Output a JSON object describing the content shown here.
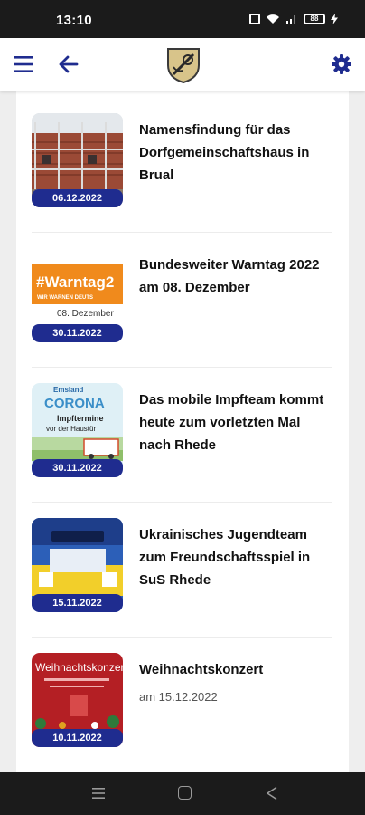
{
  "status_bar": {
    "time": "13:10",
    "battery": "88",
    "icons": [
      "nfc-icon",
      "wifi-icon",
      "signal-icon",
      "battery-icon",
      "charging-icon"
    ]
  },
  "app_bar": {
    "menu_icon": "menu-icon",
    "back_icon": "arrow-left-icon",
    "logo": "coat-of-arms-logo",
    "settings_icon": "gear-icon",
    "accent": "#1f2c8f"
  },
  "news": [
    {
      "title": "Namensfindung für das Dorfgemeinschaftshaus in Brual",
      "date": "06.12.2022",
      "subtitle": ""
    },
    {
      "title": "Bundesweiter Warntag 2022 am 08. Dezember",
      "date": "30.11.2022",
      "subtitle": "",
      "thumb_text": {
        "main": "#Warntag2",
        "sub": "WIR WARNEN DEUTS",
        "date": "08. Dezember"
      }
    },
    {
      "title": "Das mobile Impfteam kommt heute zum vorletzten Mal nach Rhede",
      "date": "30.11.2022",
      "subtitle": "",
      "thumb_text": {
        "top": "Emsland",
        "main": "CORONA",
        "sub1": "Impftermine",
        "sub2": "vor der Haustür"
      }
    },
    {
      "title": "Ukrainisches Jugendteam zum Freundschaftsspiel in SuS Rhede",
      "date": "15.11.2022",
      "subtitle": ""
    },
    {
      "title": "Weihnachtskonzert",
      "date": "10.11.2022",
      "subtitle": "am 15.12.2022",
      "thumb_text": {
        "main": "Weihnachtskonzert"
      }
    }
  ],
  "nav_bar": {
    "icons": [
      "recent-apps-icon",
      "home-icon",
      "back-icon"
    ]
  }
}
